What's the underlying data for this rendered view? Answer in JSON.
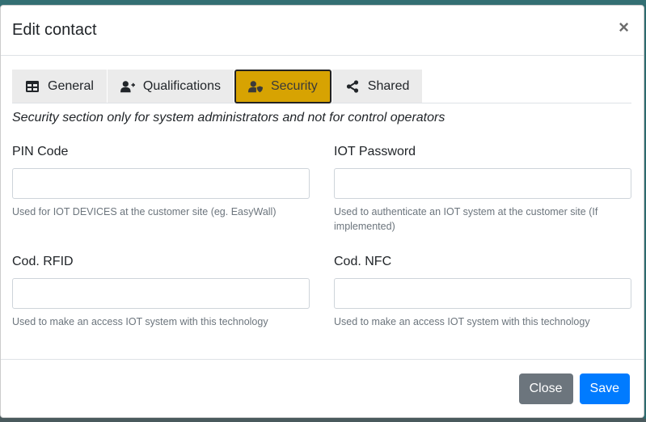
{
  "modal": {
    "title": "Edit contact",
    "close_symbol": "×"
  },
  "tabs": [
    {
      "label": "General",
      "icon": "table-icon",
      "active": false
    },
    {
      "label": "Qualifications",
      "icon": "user-plus-icon",
      "active": false
    },
    {
      "label": "Security",
      "icon": "user-shield-icon",
      "active": true
    },
    {
      "label": "Shared",
      "icon": "share-icon",
      "active": false
    }
  ],
  "security_note": "Security section only for system administrators and not for control operators",
  "fields": {
    "pin": {
      "label": "PIN Code",
      "value": "",
      "help": "Used for IOT DEVICES at the customer site (eg. EasyWall)"
    },
    "iot_password": {
      "label": "IOT Password",
      "value": "",
      "help": "Used to authenticate an IOT system at the customer site (If implemented)"
    },
    "rfid": {
      "label": "Cod. RFID",
      "value": "",
      "help": "Used to make an access IOT system with this technology"
    },
    "nfc": {
      "label": "Cod. NFC",
      "value": "",
      "help": "Used to make an access IOT system with this technology"
    }
  },
  "footer": {
    "close_label": "Close",
    "save_label": "Save"
  },
  "colors": {
    "active_tab": "#d7a302",
    "primary": "#007bff",
    "secondary": "#6c757d"
  }
}
